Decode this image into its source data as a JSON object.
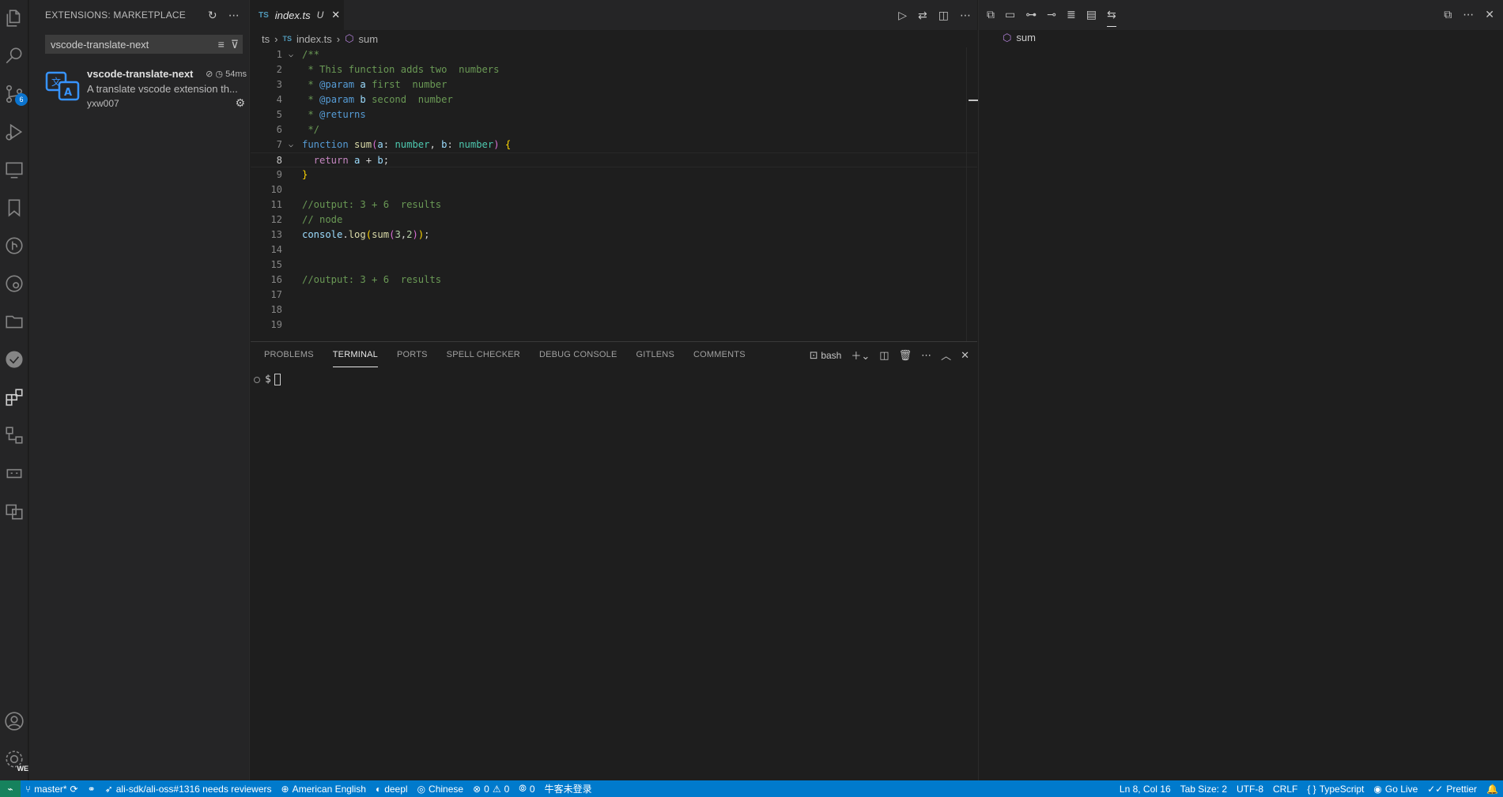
{
  "sidebar": {
    "title": "EXTENSIONS: MARKETPLACE",
    "search_value": "vscode-translate-next",
    "extension": {
      "name": "vscode-translate-next",
      "time": "54ms",
      "description": "A translate vscode extension th...",
      "author": "yxw007"
    }
  },
  "activity_bar": {
    "scm_badge": "6",
    "manage_badge": "WE",
    "icons": [
      "explorer-icon",
      "search-icon",
      "source-control-icon",
      "run-debug-icon",
      "remote-explorer-icon",
      "bookmarks-icon",
      "gitlens-icon",
      "docker-icon",
      "folder-icon",
      "todo-icon",
      "extensions-icon",
      "tree-icon",
      "api-icon",
      "translate-icon",
      "accounts-icon",
      "manage-icon"
    ]
  },
  "editor": {
    "tab": {
      "lang": "TS",
      "title": "index.ts",
      "status": "U"
    },
    "breadcrumbs": {
      "folder": "ts",
      "lang": "TS",
      "file": "index.ts",
      "symbol": "sum"
    },
    "lines": [
      "1",
      "2",
      "3",
      "4",
      "5",
      "6",
      "7",
      "8",
      "9",
      "10",
      "11",
      "12",
      "13",
      "14",
      "15",
      "16",
      "17",
      "18",
      "19"
    ],
    "code": {
      "l1": "/**",
      "l2": " * This function adds two  numbers",
      "l3_a": " * ",
      "l3_tag": "@param",
      "l3_var": " a",
      "l3_rest": " first  number",
      "l4_a": " * ",
      "l4_tag": "@param",
      "l4_var": " b",
      "l4_rest": " second  number",
      "l5_a": " * ",
      "l5_tag": "@returns",
      "l6": " */",
      "l7_kw": "function",
      "l7_fn": " sum",
      "l7_p1": "(",
      "l7_a": "a",
      "l7_c1": ": ",
      "l7_t1": "number",
      "l7_c2": ", ",
      "l7_b": "b",
      "l7_c3": ": ",
      "l7_t2": "number",
      "l7_p2": ")",
      "l7_sp": " ",
      "l7_br": "{",
      "l8_kw": "  return",
      "l8_a": " a",
      "l8_op": " + ",
      "l8_b": "b",
      "l8_end": ";",
      "l9": "}",
      "l11": "//output: 3 + 6  results",
      "l12": "// node",
      "l13_obj": "console",
      "l13_dot": ".",
      "l13_fn": "log",
      "l13_p1": "(",
      "l13_fn2": "sum",
      "l13_p2": "(",
      "l13_n1": "3",
      "l13_comma": ",",
      "l13_n2": "2",
      "l13_p3": ")",
      "l13_p4": ")",
      "l13_end": ";",
      "l16": "//output: 3 + 6  results"
    }
  },
  "panel": {
    "tabs": [
      "PROBLEMS",
      "TERMINAL",
      "PORTS",
      "SPELL CHECKER",
      "DEBUG CONSOLE",
      "GITLENS",
      "COMMENTS"
    ],
    "active_tab": "TERMINAL",
    "shell": "bash",
    "prompt": "$"
  },
  "group2": {
    "symbol": "sum"
  },
  "status": {
    "branch": "master*",
    "pr": "ali-sdk/ali-oss#1316 needs reviewers",
    "spell_lang": "American English",
    "translator": "deepl",
    "target_lang": "Chinese",
    "errors": "0",
    "warnings": "0",
    "ports": "0",
    "login": "牛客未登录",
    "position": "Ln 8, Col 16",
    "tab_size": "Tab Size: 2",
    "encoding": "UTF-8",
    "eol": "CRLF",
    "language": "TypeScript",
    "live": "Go Live",
    "prettier": "Prettier"
  },
  "colors": {
    "accent": "#007acc",
    "remote": "#16825d",
    "background": "#1e1e1e",
    "sidebar": "#252526"
  }
}
